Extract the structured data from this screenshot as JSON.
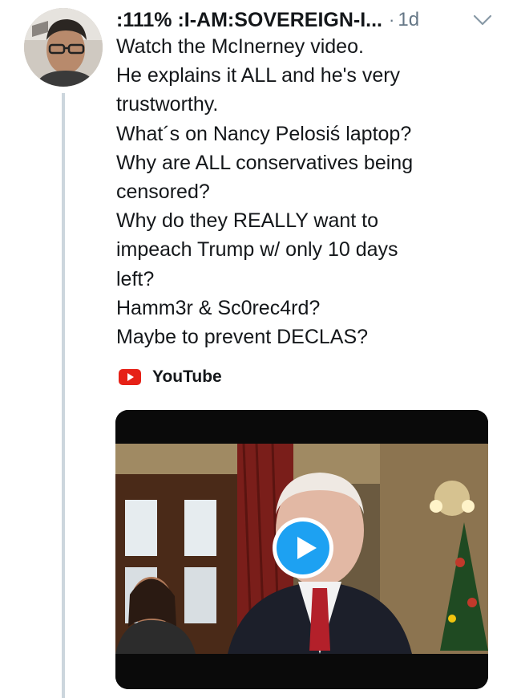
{
  "tweet": {
    "display_name": ":111% :I-AM:SOVEREIGN-I...",
    "separator": "·",
    "timestamp": "1d",
    "lines": [
      "Watch the McInerney video.",
      "He explains it ALL and he's very",
      "trustworthy.",
      "What´s on Nancy Pelosiś laptop?",
      "Why are ALL conservatives being",
      "censored?",
      "Why do they REALLY want to",
      "impeach Trump w/ only 10 days",
      "left?",
      "Hamm3r & Sc0rec4rd?",
      "Maybe to prevent DECLAS?"
    ]
  },
  "card": {
    "source_label": "YouTube",
    "source_icon": "youtube-icon",
    "play_icon": "play-icon"
  },
  "icons": {
    "more_menu": "chevron-down-icon"
  },
  "colors": {
    "text": "#14171a",
    "secondary_text": "#657786",
    "thread_line": "#ccd6dd",
    "play_button": "#1da1f2",
    "youtube_red": "#e62117"
  }
}
